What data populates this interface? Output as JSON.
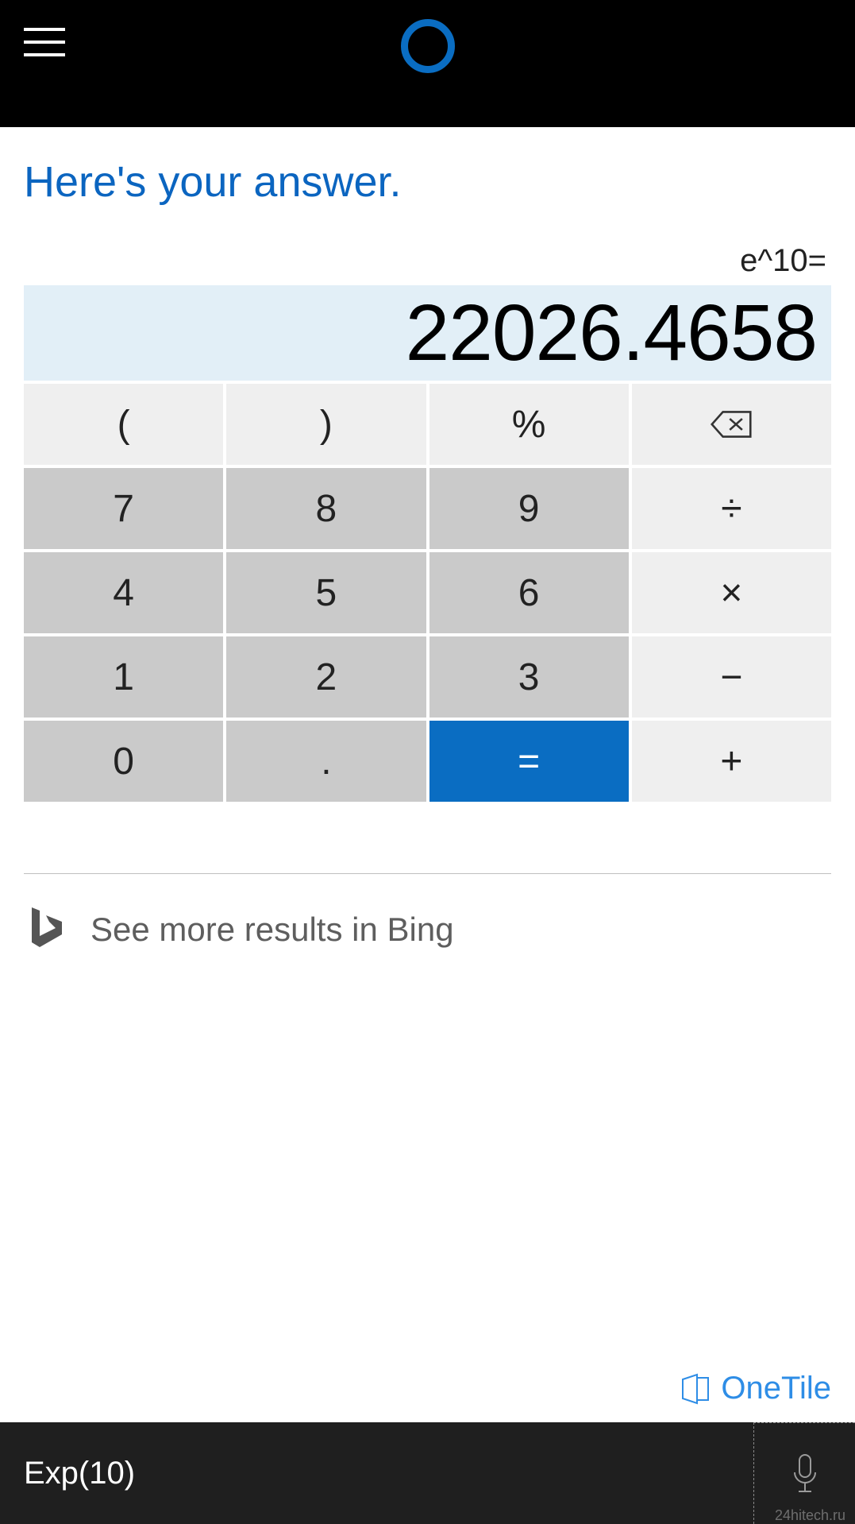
{
  "heading": "Here's your answer.",
  "calculator": {
    "expression": "e^10=",
    "result": "22026.4658",
    "keys": {
      "r0": [
        "(",
        ")",
        "%",
        "⌫"
      ],
      "r1": [
        "7",
        "8",
        "9",
        "÷"
      ],
      "r2": [
        "4",
        "5",
        "6",
        "×"
      ],
      "r3": [
        "1",
        "2",
        "3",
        "−"
      ],
      "r4": [
        "0",
        ".",
        "=",
        "+"
      ]
    }
  },
  "bing": {
    "label": "See more results in Bing"
  },
  "onetile": {
    "label": "OneTile"
  },
  "footer": {
    "query": "Exp(10)"
  },
  "watermark": "24hitech.ru"
}
